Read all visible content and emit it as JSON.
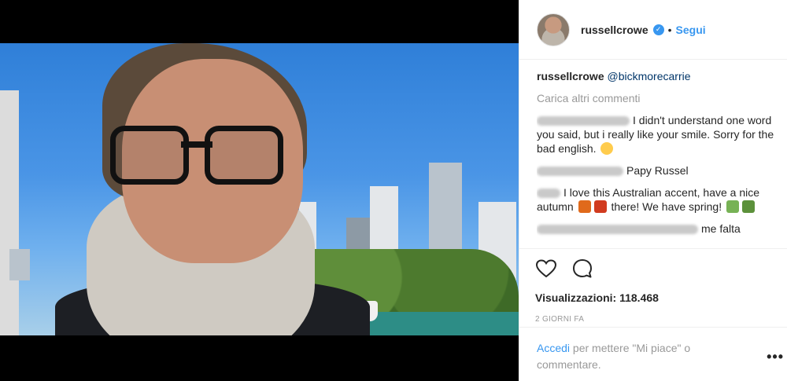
{
  "post": {
    "username": "russellcrowe",
    "follow_label": "Segui",
    "separator": "•"
  },
  "comments": {
    "caption_user": "russellcrowe",
    "caption_mention": "@bickmorecarrie",
    "load_more": "Carica altri commenti",
    "items": [
      {
        "text": "I didn't understand one word you said, but i really like your smile. Sorry for the bad english."
      },
      {
        "text": "Papy Russel"
      },
      {
        "text": "I love this Australian accent, have a nice autumn",
        "text2": "there! We have spring!"
      },
      {
        "text": "me falta"
      }
    ]
  },
  "actions": {
    "like_icon": "heart-icon",
    "comment_icon": "comment-bubble-icon",
    "views_label": "Visualizzazioni: 118.468",
    "time": "2 giorni fa"
  },
  "login": {
    "link": "Accedi",
    "text": " per mettere \"Mi piace\" o commentare.",
    "more": "•••"
  },
  "colors": {
    "accent": "#3897f0",
    "text": "#262626",
    "muted": "#999999"
  }
}
